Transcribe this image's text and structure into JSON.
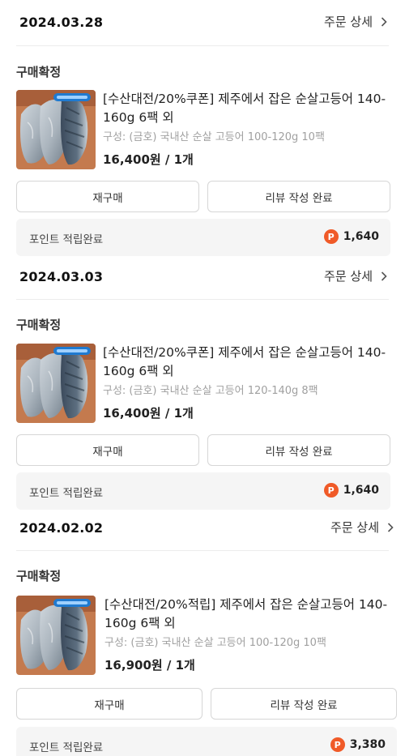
{
  "orders": [
    {
      "date": "2024.03.28",
      "detail_label": "주문 상세",
      "status": "구매확정",
      "title": "[수산대전/20%쿠폰] 제주에서 잡은 순살고등어 140-160g 6팩 외",
      "option": "구성: (금호) 국내산 순살 고등어 100-120g 10팩",
      "price": "16,400원 / 1개",
      "rebuy_label": "재구매",
      "review_label": "리뷰 작성 완료",
      "point_label": "포인트 적립완료",
      "point_icon": "P",
      "point_value": "1,640"
    },
    {
      "date": "2024.03.03",
      "detail_label": "주문 상세",
      "status": "구매확정",
      "title": "[수산대전/20%쿠폰] 제주에서 잡은 순살고등어 140-160g 6팩 외",
      "option": "구성: (금호) 국내산 순살 고등어 120-140g 8팩",
      "price": "16,400원 / 1개",
      "rebuy_label": "재구매",
      "review_label": "리뷰 작성 완료",
      "point_label": "포인트 적립완료",
      "point_icon": "P",
      "point_value": "1,640"
    },
    {
      "date": "2024.02.02",
      "detail_label": "주문 상세",
      "status": "구매확정",
      "title": "[수산대전/20%적립] 제주에서 잡은 순살고등어 140-160g 6팩 외",
      "option": "구성: (금호) 국내산 순살 고등어 100-120g 10팩",
      "price": "16,900원 / 1개",
      "rebuy_label": "재구매",
      "review_label": "리뷰 작성 완료",
      "point_label": "포인트 적립완료",
      "point_icon": "P",
      "point_value": "3,380"
    }
  ],
  "colors": {
    "point_badge": "#f05a28",
    "button_border": "#d6d6d6",
    "point_box_bg": "#f5f5f5",
    "muted_text": "#a0a0a0"
  },
  "icons": {
    "detail_chevron": "chevron-right-icon",
    "point_badge": "point-coin-icon"
  }
}
